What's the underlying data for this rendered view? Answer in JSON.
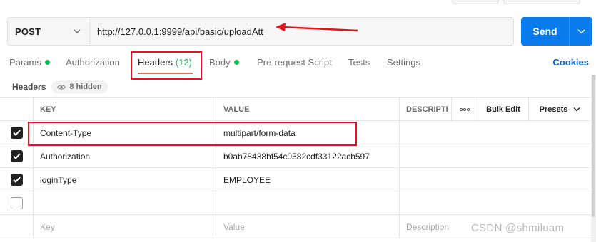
{
  "request": {
    "method": "POST",
    "url": "http://127.0.0.1:9999/api/basic/uploadAtt",
    "send_label": "Send"
  },
  "tabs": [
    {
      "label": "Params",
      "dot": true
    },
    {
      "label": "Authorization"
    },
    {
      "label": "Headers",
      "count": "(12)",
      "active": true
    },
    {
      "label": "Body",
      "dot": true
    },
    {
      "label": "Pre-request Script"
    },
    {
      "label": "Tests"
    },
    {
      "label": "Settings"
    }
  ],
  "cookies_label": "Cookies",
  "headers_section": {
    "title": "Headers",
    "hidden_label": "8 hidden"
  },
  "table": {
    "columns": {
      "key": "KEY",
      "value": "VALUE",
      "description": "DESCRIPTI",
      "more": "ooo",
      "bulk_edit": "Bulk Edit",
      "presets": "Presets"
    },
    "rows": [
      {
        "checked": true,
        "key": "Content-Type",
        "value": "multipart/form-data",
        "description": ""
      },
      {
        "checked": true,
        "key": "Authorization",
        "value": "b0ab78438bf54c0582cdf33122acb597",
        "description": ""
      },
      {
        "checked": true,
        "key": "loginType",
        "value": "EMPLOYEE",
        "description": ""
      },
      {
        "checked": false,
        "key": "",
        "value": "",
        "description": ""
      }
    ],
    "placeholders": {
      "key": "Key",
      "value": "Value",
      "description": "Description"
    }
  },
  "watermark": "CSDN @shmiluam",
  "colors": {
    "send": "#097bed",
    "active_tab_underline": "#f26b3a",
    "status_dot": "#0cbb52",
    "annotation": "#e5131b",
    "link": "#0265d2"
  },
  "icons": [
    "chevron-down-icon",
    "eye-icon",
    "checkmark-icon",
    "more-horizontal-icon"
  ]
}
